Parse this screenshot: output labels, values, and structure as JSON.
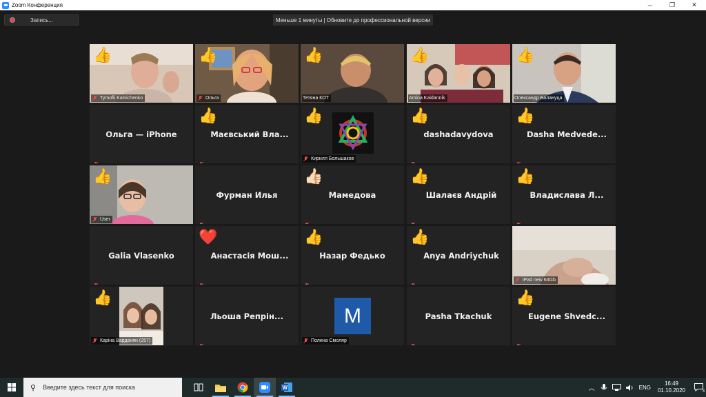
{
  "window": {
    "title": "Zoom Конференция",
    "minimize": "─",
    "maximize": "❐",
    "close": "✕"
  },
  "toolbar": {
    "record_label": "Запись..."
  },
  "banner": {
    "text": "Меньше 1 минуты | Обновите до профессиональной версии"
  },
  "colors": {
    "active_speaker": "#c8e65a",
    "muted_mic": "#e74c4c",
    "thumbs_up": "#f4c43b"
  },
  "participants": [
    {
      "name": "Tymofii Kalnichenko",
      "reaction": "👍"
    },
    {
      "name": "Ольга",
      "reaction": "👍",
      "active": true
    },
    {
      "name": "Тетяна КОТ",
      "reaction": "👍"
    },
    {
      "name": "Amina Kaidannik",
      "reaction": "👍"
    },
    {
      "name": "Олександр Балануца",
      "reaction": "👍"
    },
    {
      "name": "Ольга — iPhone",
      "reaction": ""
    },
    {
      "name": "Маєвський Вла...",
      "reaction": "👍"
    },
    {
      "name": "Кирилл Большаков",
      "reaction": "👍"
    },
    {
      "name": "dashadavydova",
      "reaction": "👍"
    },
    {
      "name": "Dasha Medvede...",
      "reaction": "👍"
    },
    {
      "name": "User",
      "reaction": "👍"
    },
    {
      "name": "Фурман Илья",
      "reaction": ""
    },
    {
      "name": "Мамедова",
      "reaction": "👍🏻"
    },
    {
      "name": "Шалаєв Андрій",
      "reaction": "👍"
    },
    {
      "name": "Владислава Л...",
      "reaction": "👍"
    },
    {
      "name": "Galia Vlasenko",
      "reaction": ""
    },
    {
      "name": "Анастасія Мош...",
      "reaction": "❤️"
    },
    {
      "name": "Назар Федько",
      "reaction": "👍"
    },
    {
      "name": "Anya Andriychuk",
      "reaction": "👍"
    },
    {
      "name": "iPad new 64Gb",
      "reaction": ""
    },
    {
      "name": "Каріна Варданян (257)",
      "reaction": "👍"
    },
    {
      "name": "Льоша Репрін...",
      "reaction": ""
    },
    {
      "name": "Полина Смоляр",
      "reaction": "",
      "avatar_letter": "M"
    },
    {
      "name": "Pasha Tkachuk",
      "reaction": ""
    },
    {
      "name": "Eugene Shvedc...",
      "reaction": "👍"
    }
  ],
  "taskbar": {
    "search_placeholder": "Введите здесь текст для поиска",
    "apps": [
      "task-view",
      "file-explorer",
      "chrome",
      "zoom",
      "word"
    ],
    "language": "ENG",
    "time": "16:49",
    "date": "01.10.2020",
    "notification_count": "3"
  }
}
